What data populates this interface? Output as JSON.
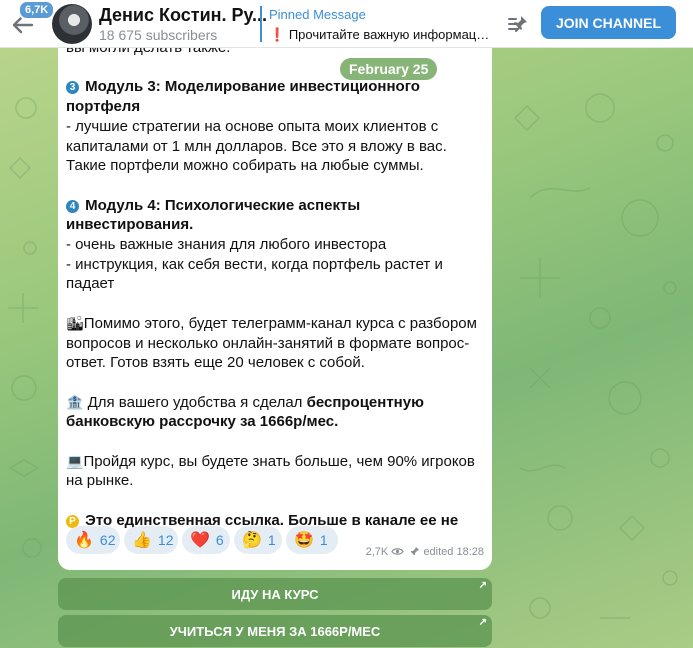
{
  "header": {
    "back_badge": "6,7K",
    "title": "Денис Костин. Ру...",
    "subscribers": "18 675 subscribers",
    "pinned_label": "Pinned Message",
    "pinned_mark": "❗",
    "pinned_text": "Прочитайте важную информаци...",
    "join_label": "JOIN CHANNEL"
  },
  "date": "February 25",
  "message": {
    "top_line": "вы могли делать также.",
    "m3_num": "3",
    "m3_title": "Модуль 3: Моделирование инвестиционного портфеля",
    "m3_body": "- лучшие стратегии на основе опыта моих клиентов с капиталами от 1 млн долларов. Все это я вложу в вас. Такие портфели можно собирать на любые суммы.",
    "m4_num": "4",
    "m4_title": "Модуль 4: Психологические аспекты инвестирования.",
    "m4_line1": "- очень важные знания для любого инвестора",
    "m4_line2": "- инструкция, как себя вести, когда портфель растет и падает",
    "p1_emoji": "🏙",
    "p1_text": "Помимо этого, будет телеграмм-канал курса с разбором вопросов и несколько онлайн-занятий в формате вопрос-ответ. Готов взять еще 20 человек с собой.",
    "p2_emoji": "🏦",
    "p2_text": " Для вашего удобства я сделал ",
    "p2_bold": "беспроцентную банковскую рассрочку за 1666р/мес.",
    "p3_emoji": "💻",
    "p3_text": "Пройдя курс, вы будете знать больше, чем 90% игроков на рынке.",
    "p4_num": "P",
    "p4_text": "Это единственная ссылка. Больше в канале ее не будет"
  },
  "reactions": [
    {
      "emoji": "🔥",
      "count": "62"
    },
    {
      "emoji": "👍",
      "count": "12"
    },
    {
      "emoji": "❤️",
      "count": "6"
    },
    {
      "emoji": "🤔",
      "count": "1"
    },
    {
      "emoji": "🤩",
      "count": "1"
    }
  ],
  "meta": {
    "views": "2,7K",
    "edited": "edited 18:28"
  },
  "buttons": {
    "course": "ИДУ НА КУРС",
    "learn": "УЧИТЬСЯ У МЕНЯ ЗА 1666Р/МЕС"
  },
  "colors": {
    "accent": "#3a8fd8",
    "chat_bg": "#98c77c",
    "bubble": "#ffffff"
  }
}
